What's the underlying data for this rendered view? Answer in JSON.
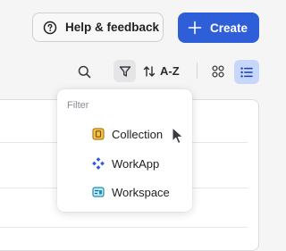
{
  "header": {
    "help_label": "Help & feedback",
    "create_label": "Create"
  },
  "toolbar": {
    "sort_label": "A-Z"
  },
  "filter_menu": {
    "heading": "Filter",
    "items": [
      {
        "label": "Collection",
        "icon": "collection-icon",
        "color": "#d99a1a"
      },
      {
        "label": "WorkApp",
        "icon": "workapp-icon",
        "color": "#2f5fd8"
      },
      {
        "label": "Workspace",
        "icon": "workspace-icon",
        "color": "#1b8fb5"
      }
    ]
  },
  "colors": {
    "accent": "#2f5fd8",
    "list_view_active": "#c7d6fb"
  }
}
